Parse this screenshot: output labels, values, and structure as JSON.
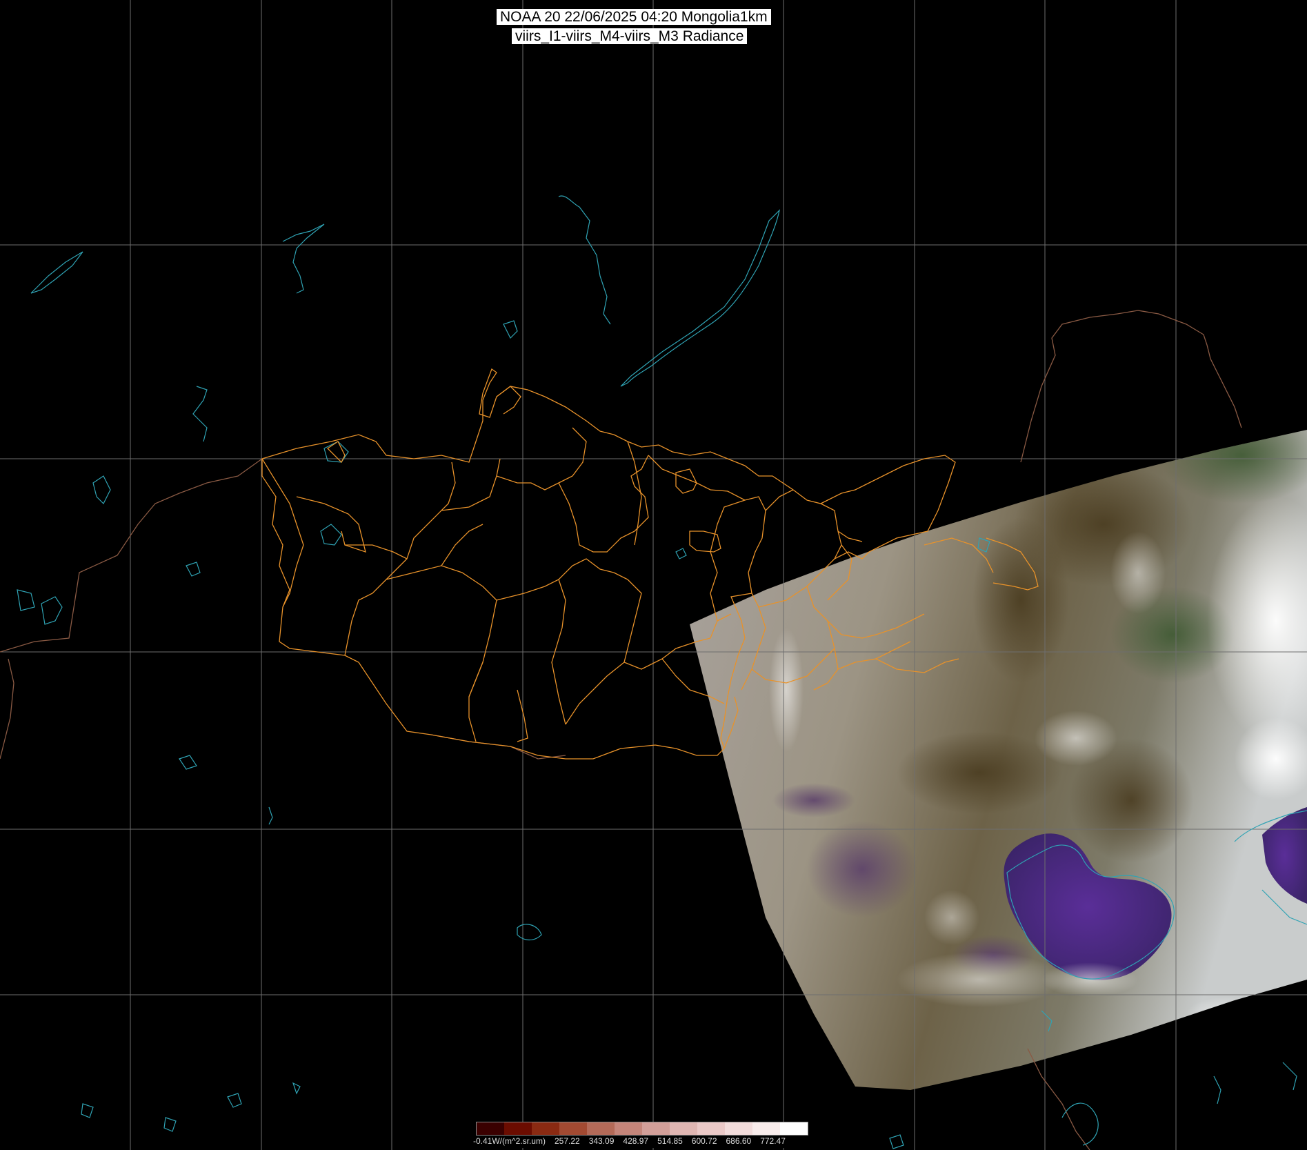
{
  "title": {
    "line1": "NOAA 20 22/06/2025 04:20 Mongolia1km",
    "line2": "viirs_I1-viirs_M4-viirs_M3 Radiance"
  },
  "legend": {
    "labels": [
      "-0.41W/(m^2.sr.um)",
      "257.22",
      "343.09",
      "428.97",
      "514.85",
      "600.72",
      "686.60",
      "772.47"
    ],
    "colors": [
      "#3a0000",
      "#6b0c00",
      "#8a2a12",
      "#a24a32",
      "#b36a58",
      "#c4857a",
      "#d29f99",
      "#dfb6b2",
      "#eac9c7",
      "#f2dcdb",
      "#f8eceb",
      "#ffffff"
    ]
  },
  "colors": {
    "background": "#000000",
    "graticule": "#6e6e6e",
    "admin_boundaries": "#e8922a",
    "coastlines_lakes": "#2fa3b4",
    "country_borders": "#8a5a44"
  }
}
